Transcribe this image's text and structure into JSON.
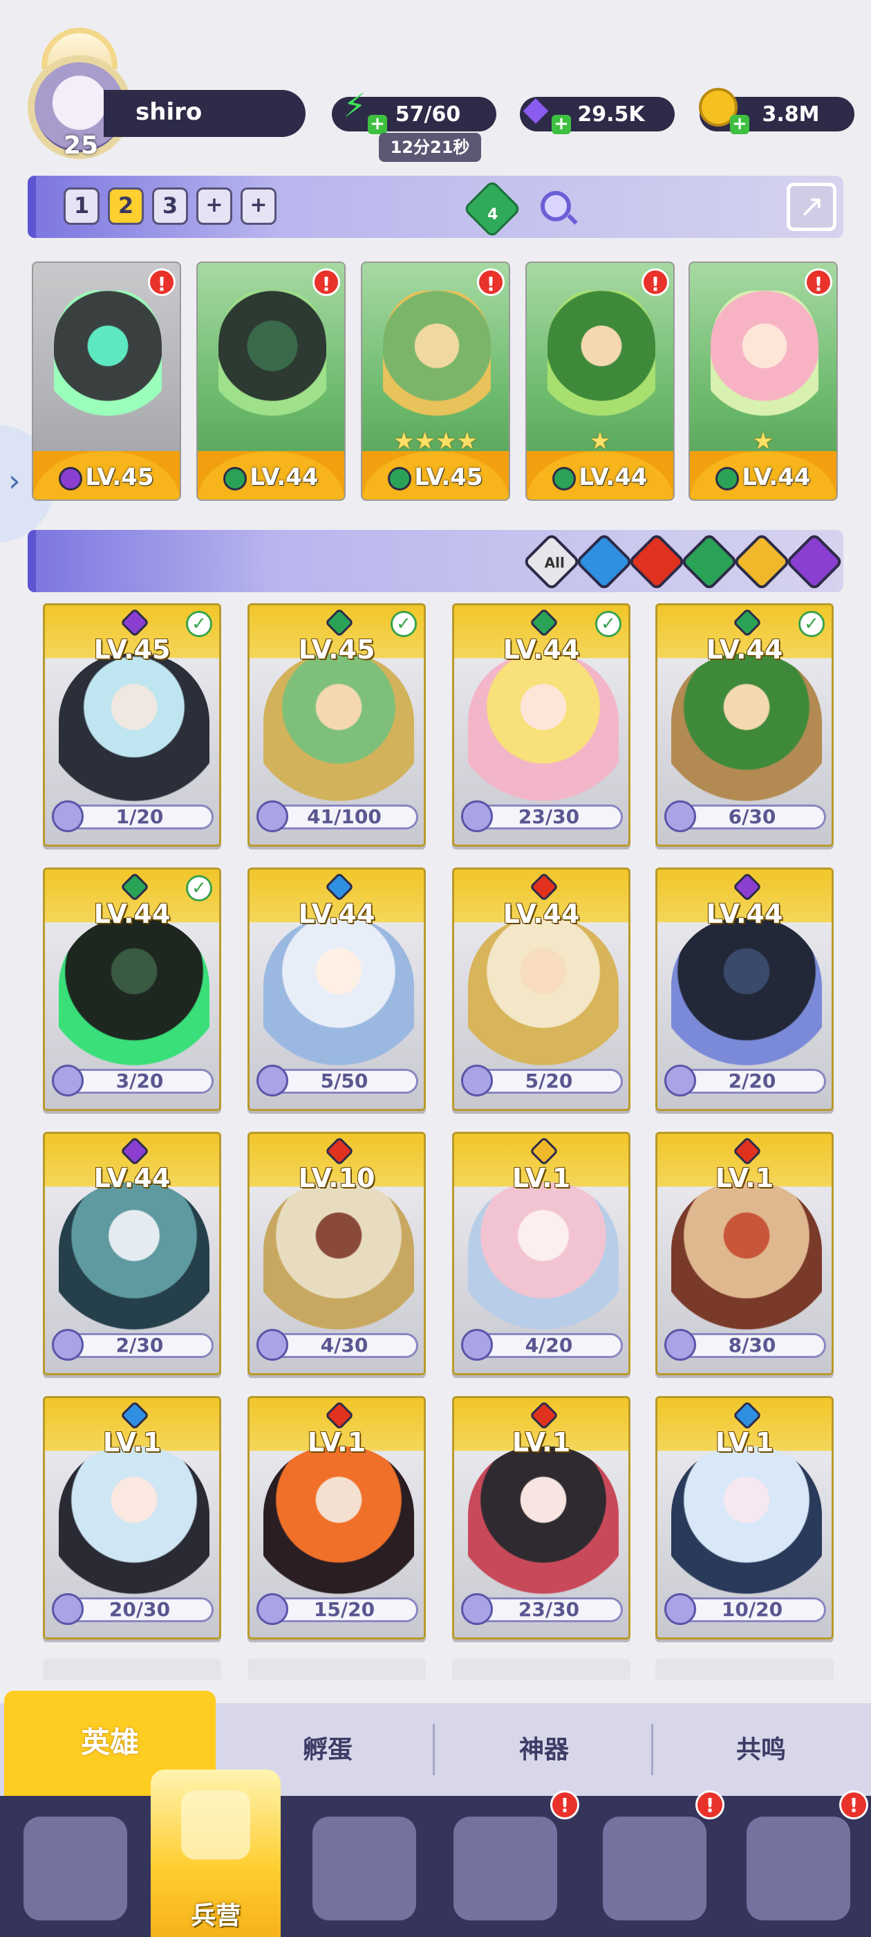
{
  "player": {
    "level": "25",
    "name": "shiro"
  },
  "resources": {
    "energy": "57/60",
    "energy_timer": "12分21秒",
    "gems": "29.5K",
    "coins": "3.8M"
  },
  "team_tabs": [
    "1",
    "2",
    "3",
    "+",
    "+"
  ],
  "team_active": "2",
  "team_gem_count": "4",
  "team": [
    {
      "level": "LV.45",
      "element": "dark",
      "alert": "!",
      "stars": ""
    },
    {
      "level": "LV.44",
      "element": "nature",
      "alert": "!",
      "stars": ""
    },
    {
      "level": "LV.45",
      "element": "nature",
      "alert": "!",
      "stars": "★★★★"
    },
    {
      "level": "LV.44",
      "element": "nature",
      "alert": "!",
      "stars": "★"
    },
    {
      "level": "LV.44",
      "element": "nature",
      "alert": "!",
      "stars": "★"
    }
  ],
  "filters": [
    "All",
    "water",
    "fire",
    "nature",
    "light",
    "dark"
  ],
  "filter_all_label": "All",
  "heroes": [
    {
      "level": "LV.45",
      "progress": "1/20",
      "element": "dark",
      "checked": true
    },
    {
      "level": "LV.45",
      "progress": "41/100",
      "element": "nature",
      "checked": true
    },
    {
      "level": "LV.44",
      "progress": "23/30",
      "element": "nature",
      "checked": true
    },
    {
      "level": "LV.44",
      "progress": "6/30",
      "element": "nature",
      "checked": true
    },
    {
      "level": "LV.44",
      "progress": "3/20",
      "element": "nature",
      "checked": true
    },
    {
      "level": "LV.44",
      "progress": "5/50",
      "element": "water",
      "checked": false
    },
    {
      "level": "LV.44",
      "progress": "5/20",
      "element": "fire",
      "checked": false
    },
    {
      "level": "LV.44",
      "progress": "2/20",
      "element": "dark",
      "checked": false
    },
    {
      "level": "LV.44",
      "progress": "2/30",
      "element": "dark",
      "checked": false
    },
    {
      "level": "LV.10",
      "progress": "4/30",
      "element": "fire",
      "checked": false
    },
    {
      "level": "LV.1",
      "progress": "4/20",
      "element": "light",
      "checked": false
    },
    {
      "level": "LV.1",
      "progress": "8/30",
      "element": "fire",
      "checked": false
    },
    {
      "level": "LV.1",
      "progress": "20/30",
      "element": "water",
      "checked": false
    },
    {
      "level": "LV.1",
      "progress": "15/20",
      "element": "fire",
      "checked": false
    },
    {
      "level": "LV.1",
      "progress": "23/30",
      "element": "fire",
      "checked": false
    },
    {
      "level": "LV.1",
      "progress": "10/20",
      "element": "water",
      "checked": false
    }
  ],
  "sub_tabs": [
    "英雄",
    "孵蛋",
    "神器",
    "共鸣"
  ],
  "nav": {
    "center_label": "兵营",
    "alert": "!"
  },
  "colors": {
    "water": "#2f8fe0",
    "fire": "#e0321e",
    "nature": "#2aa356",
    "light": "#f0b82a",
    "dark": "#8a3fd0",
    "accent": "#ffcc22"
  }
}
